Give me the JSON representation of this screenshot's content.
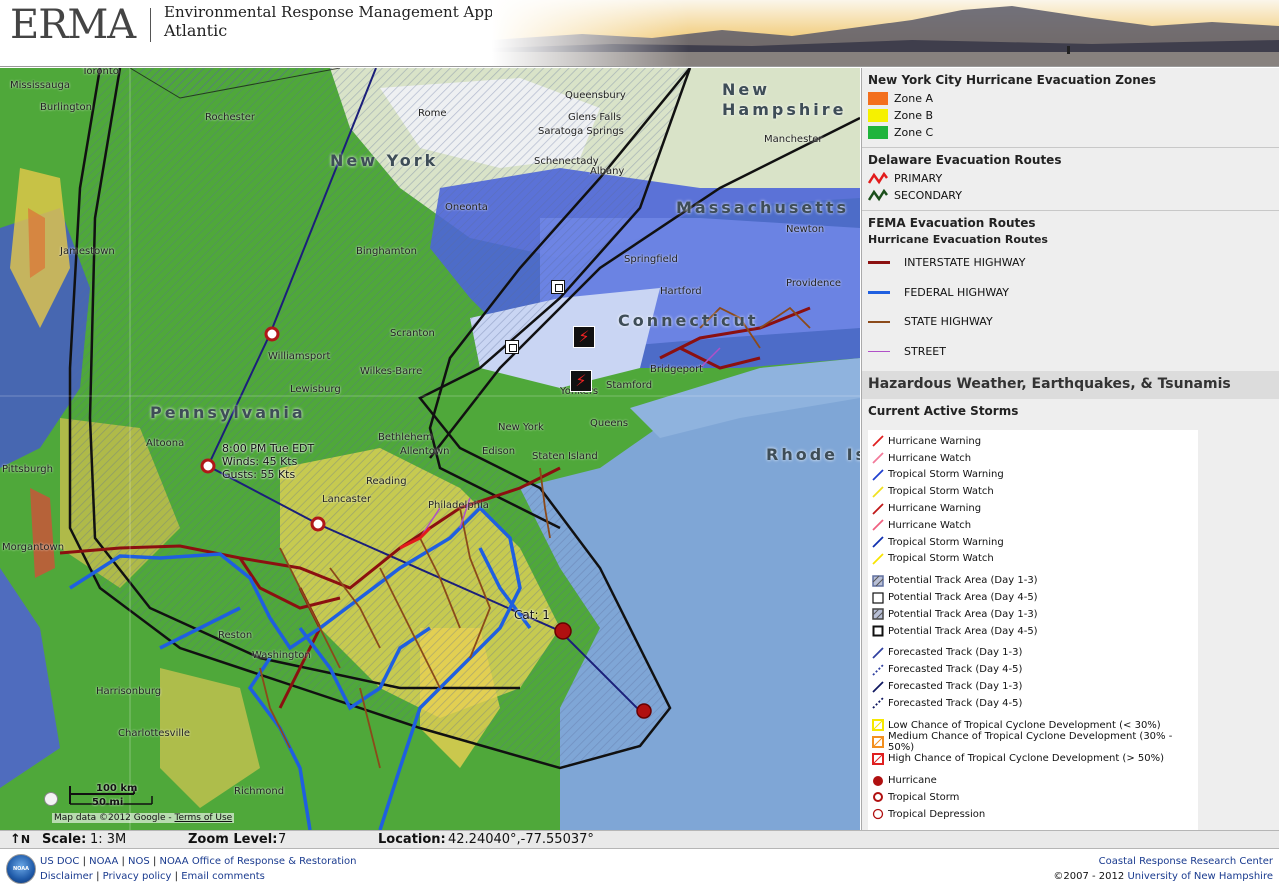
{
  "header": {
    "logo_text": "ERMA",
    "app_name": "Environmental Response Management Application",
    "region": "Atlantic"
  },
  "map": {
    "state_labels": [
      "New York",
      "Pennsylvania",
      "New Hampshire",
      "Massachusetts",
      "Connecticut",
      "Rhode Is"
    ],
    "city_labels": [
      "Mississauga",
      "Toronto",
      "Burlington",
      "Rochester",
      "Rome",
      "Queensbury",
      "Glens Falls",
      "Saratoga Springs",
      "Schenectady",
      "Albany",
      "Oneonta",
      "Binghamton",
      "Jamestown",
      "Scranton",
      "Williamsport",
      "Wilkes-Barre",
      "Lewisburg",
      "Hartford",
      "Springfield",
      "Manchester",
      "Providence",
      "Newton",
      "Bridgeport",
      "Stamford",
      "Yonkers",
      "New York",
      "Queens",
      "Edison",
      "Allentown",
      "Bethlehem",
      "Lancaster",
      "Reading",
      "Philadelphia",
      "Altoona",
      "Pittsburgh",
      "Morgantown",
      "Reston",
      "Washington",
      "Harrisonburg",
      "Charlottesville",
      "Richmond",
      "Staten Island"
    ],
    "storm_info": {
      "time": "8:00 PM Tue EDT",
      "winds": "Winds: 45 Kts",
      "gusts": "Gusts: 55 Kts",
      "category": "Cat: 1"
    },
    "scale_km": "100 km",
    "scale_mi": "50 mi",
    "attribution": "Map data ©2012 Google -",
    "terms": "Terms of Use",
    "colors": {
      "radar_green": "#4fa83a",
      "radar_yellow": "#e8d24a",
      "radar_blue": "#3f5bd8",
      "ocean": "#7fa6d6",
      "cone_line": "#111111",
      "track_line": "#1b1f7a"
    }
  },
  "legend": {
    "nyc": {
      "title": "New York City Hurricane Evacuation Zones",
      "zones": [
        {
          "label": "Zone A",
          "color": "#f36f1d"
        },
        {
          "label": "Zone B",
          "color": "#f6f100"
        },
        {
          "label": "Zone C",
          "color": "#1fb43c"
        }
      ]
    },
    "delaware": {
      "title": "Delaware Evacuation Routes",
      "routes": [
        {
          "label": "PRIMARY",
          "color": "#e21b1b"
        },
        {
          "label": "SECONDARY",
          "color": "#1b4f1b"
        }
      ]
    },
    "fema": {
      "title": "FEMA Evacuation Routes",
      "subtitle": "Hurricane Evacuation Routes",
      "routes": [
        {
          "label": "INTERSTATE HIGHWAY",
          "color": "#8b1010"
        },
        {
          "label": "FEDERAL HIGHWAY",
          "color": "#1f5fe0"
        },
        {
          "label": "STATE HIGHWAY",
          "color": "#8b4a1a"
        },
        {
          "label": "STREET",
          "color": "#b050c8"
        }
      ]
    },
    "hazard_title": "Hazardous Weather, Earthquakes, & Tsunamis",
    "storms_title": "Current Active Storms",
    "storms": [
      {
        "label": "Hurricane Warning",
        "icon": "line-icon",
        "color": "#e02020"
      },
      {
        "label": "Hurricane Watch",
        "icon": "line-icon",
        "color": "#f27a9a"
      },
      {
        "label": "Tropical Storm Warning",
        "icon": "line-icon",
        "color": "#2040d0"
      },
      {
        "label": "Tropical Storm Watch",
        "icon": "line-icon",
        "color": "#f0e020"
      },
      {
        "label": "Hurricane Warning",
        "icon": "line-icon",
        "color": "#c01818"
      },
      {
        "label": "Hurricane Watch",
        "icon": "line-icon",
        "color": "#f06080"
      },
      {
        "label": "Tropical Storm Warning",
        "icon": "line-icon",
        "color": "#1030b0"
      },
      {
        "label": "Tropical Storm Watch",
        "icon": "line-icon",
        "color": "#f8e400"
      },
      {
        "label": "Potential Track Area (Day 1-3)",
        "icon": "hatched-box-icon",
        "color": "#6070a0"
      },
      {
        "label": "Potential Track Area (Day 4-5)",
        "icon": "box-icon",
        "color": "#111111"
      },
      {
        "label": "Potential Track Area (Day 1-3)",
        "icon": "hatched-box-icon",
        "color": "#444444"
      },
      {
        "label": "Potential Track Area (Day 4-5)",
        "icon": "box-thick-icon",
        "color": "#111111"
      },
      {
        "label": "Forecasted Track (Day 1-3)",
        "icon": "line-icon",
        "color": "#3040a0"
      },
      {
        "label": "Forecasted Track (Day 4-5)",
        "icon": "dashed-line-icon",
        "color": "#3040a0"
      },
      {
        "label": "Forecasted Track (Day 1-3)",
        "icon": "line-icon",
        "color": "#101860"
      },
      {
        "label": "Forecasted Track (Day 4-5)",
        "icon": "dashed-line-icon",
        "color": "#101860"
      },
      {
        "label": "Low Chance of Tropical Cyclone Development (< 30%)",
        "icon": "yellow-box-icon",
        "color": "#f6e800"
      },
      {
        "label": "Medium Chance of Tropical Cyclone Development (30% - 50%)",
        "icon": "orange-box-icon",
        "color": "#f39020"
      },
      {
        "label": "High Chance of Tropical Cyclone Development (> 50%)",
        "icon": "red-box-icon",
        "color": "#e02020"
      },
      {
        "label": "Hurricane",
        "icon": "hurricane-icon",
        "color": "#b01010"
      },
      {
        "label": "Tropical Storm",
        "icon": "tropical-storm-icon",
        "color": "#b01010"
      },
      {
        "label": "Tropical Depression",
        "icon": "tropical-depression-icon",
        "color": "#b01010"
      }
    ]
  },
  "status": {
    "north": "N",
    "scale_label": "Scale:",
    "scale_value": "1: 3M",
    "zoom_label": "Zoom Level:",
    "zoom_value": "7",
    "location_label": "Location:",
    "location_value": "42.24040°,-77.55037°"
  },
  "footer": {
    "links_row1": [
      "US DOC",
      "NOAA",
      "NOS",
      "NOAA Office of Response & Restoration"
    ],
    "links_row2": [
      "Disclaimer",
      "Privacy policy",
      "Email comments"
    ],
    "org": "Coastal Response Research Center",
    "copyright_prefix": "©2007 - 2012",
    "university": "University of New Hampshire",
    "noaa_logo": "NOAA"
  }
}
